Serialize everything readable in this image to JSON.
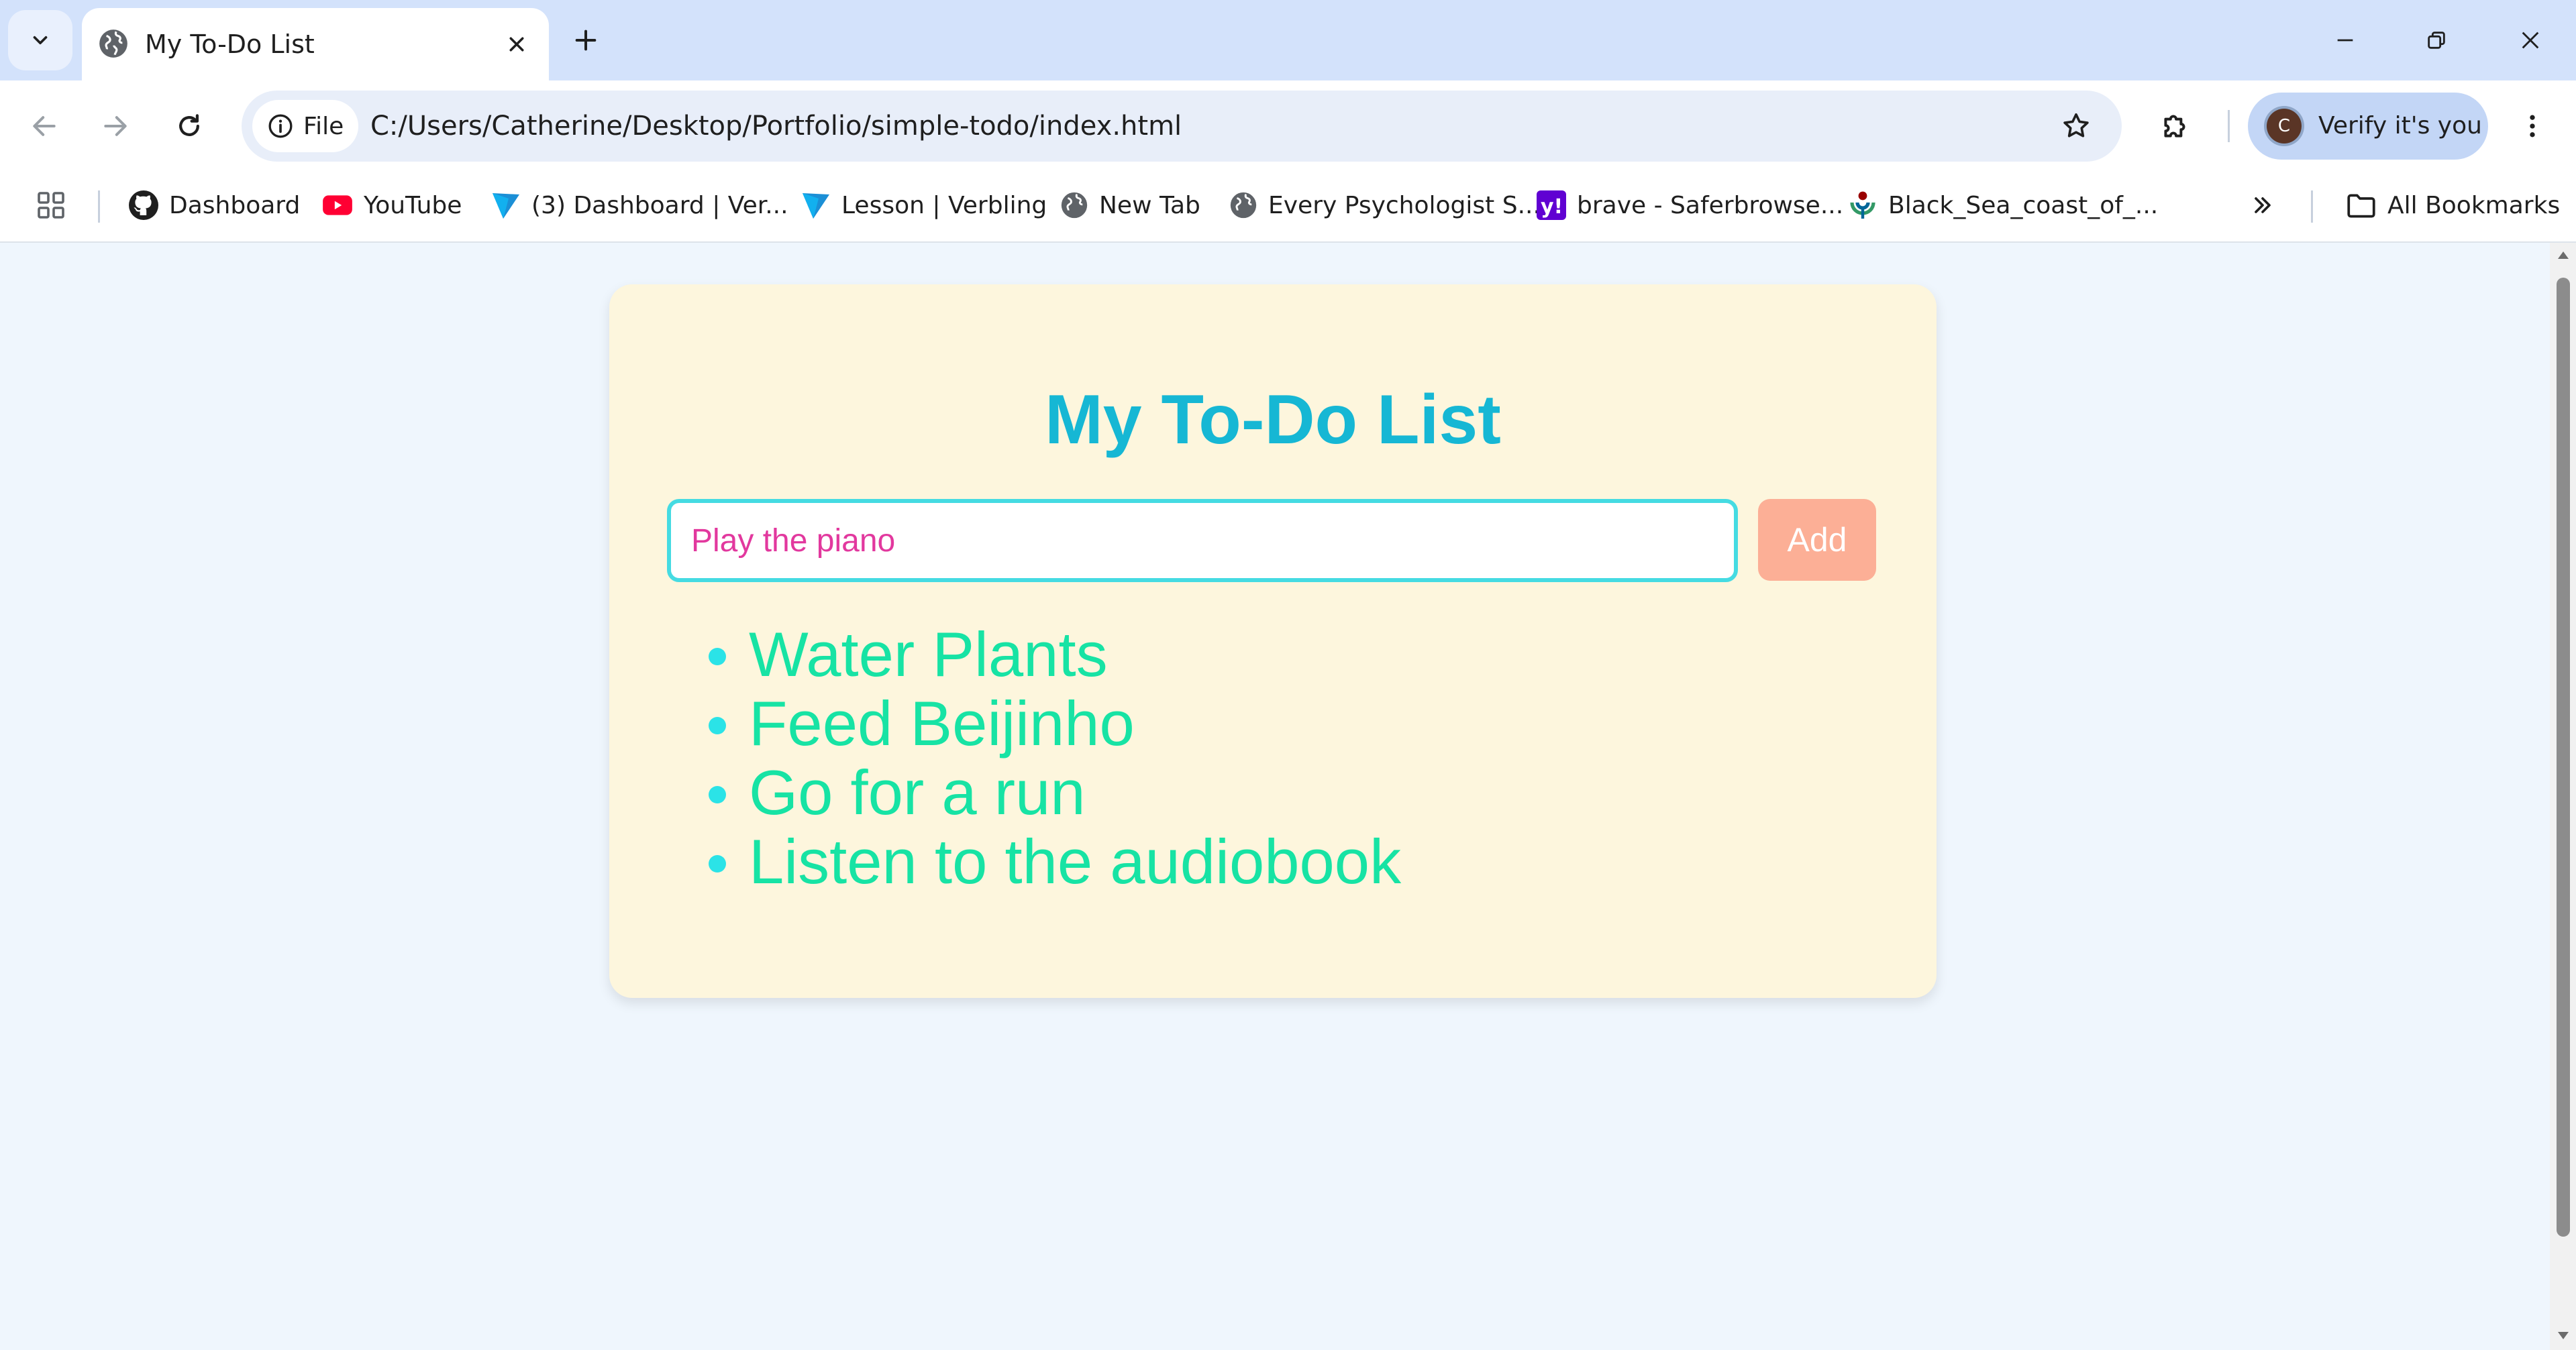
{
  "browser": {
    "tab": {
      "title": "My To-Do List"
    },
    "address_bar": {
      "scheme_chip": "File",
      "url": "C:/Users/Catherine/Desktop/Portfolio/simple-todo/index.html"
    },
    "profile": {
      "avatar_initial": "C",
      "label": "Verify it's you"
    },
    "bookmarks": [
      {
        "label": "Dashboard",
        "icon": "github-icon"
      },
      {
        "label": "YouTube",
        "icon": "youtube-icon"
      },
      {
        "label": "(3) Dashboard | Ver...",
        "icon": "verbling-icon"
      },
      {
        "label": "Lesson | Verbling",
        "icon": "verbling-icon"
      },
      {
        "label": "New Tab",
        "icon": "globe-icon"
      },
      {
        "label": "Every Psychologist S...",
        "icon": "globe-icon"
      },
      {
        "label": "brave - Saferbrowse...",
        "icon": "yahoo-icon"
      },
      {
        "label": "Black_Sea_coast_of_...",
        "icon": "wikimedia-icon"
      }
    ],
    "all_bookmarks_label": "All Bookmarks"
  },
  "app": {
    "title": "My To-Do List",
    "input": {
      "value": "Play the piano"
    },
    "add_button_label": "Add",
    "tasks": [
      "Water Plants",
      "Feed Beijinho",
      "Go for a run",
      "Listen to the audiobook"
    ]
  },
  "colors": {
    "title": "#16b7d4",
    "card_background": "#fdf6dd",
    "input_border": "#45dbe2",
    "input_text": "#e2389e",
    "add_button": "#fcaf96",
    "task_text": "#17e3a4",
    "bullet": "#2be3e7"
  }
}
